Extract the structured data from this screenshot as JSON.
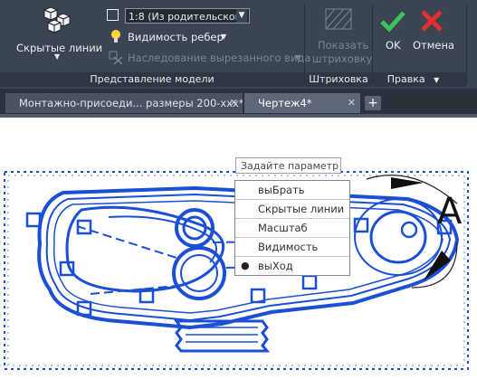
{
  "ribbon": {
    "hidden_lines_label": "Скрытые линии",
    "scale_value": "1:8 (Из родительского э",
    "edge_visibility_label": "Видимость ребер",
    "cut_inherit_label": "Наследование вырезанного вида",
    "model_view_title": "Представление модели",
    "show_hatch_line1": "Показать",
    "show_hatch_line2": "штриховку",
    "hatch_title": "Штриховка",
    "ok_label": "OK",
    "cancel_label": "Отмена",
    "edit_title": "Правка"
  },
  "tabs": [
    {
      "label": "Монтажно-присоеди... размеры 200-ххх*"
    },
    {
      "label": "Чертеж4*"
    }
  ],
  "tooltip": "Задайте параметр",
  "context_menu": [
    {
      "label": "выБрать"
    },
    {
      "label": "Скрытые линии"
    },
    {
      "label": "Масштаб"
    },
    {
      "label": "Видимость"
    },
    {
      "label": "выХод",
      "selected": true
    }
  ],
  "drawing": {
    "view_letter": "A",
    "colors": {
      "selection": "#1a4fd6",
      "ribbon": "#3b4453",
      "ok": "#3cc25a",
      "cancel": "#e03030"
    }
  }
}
